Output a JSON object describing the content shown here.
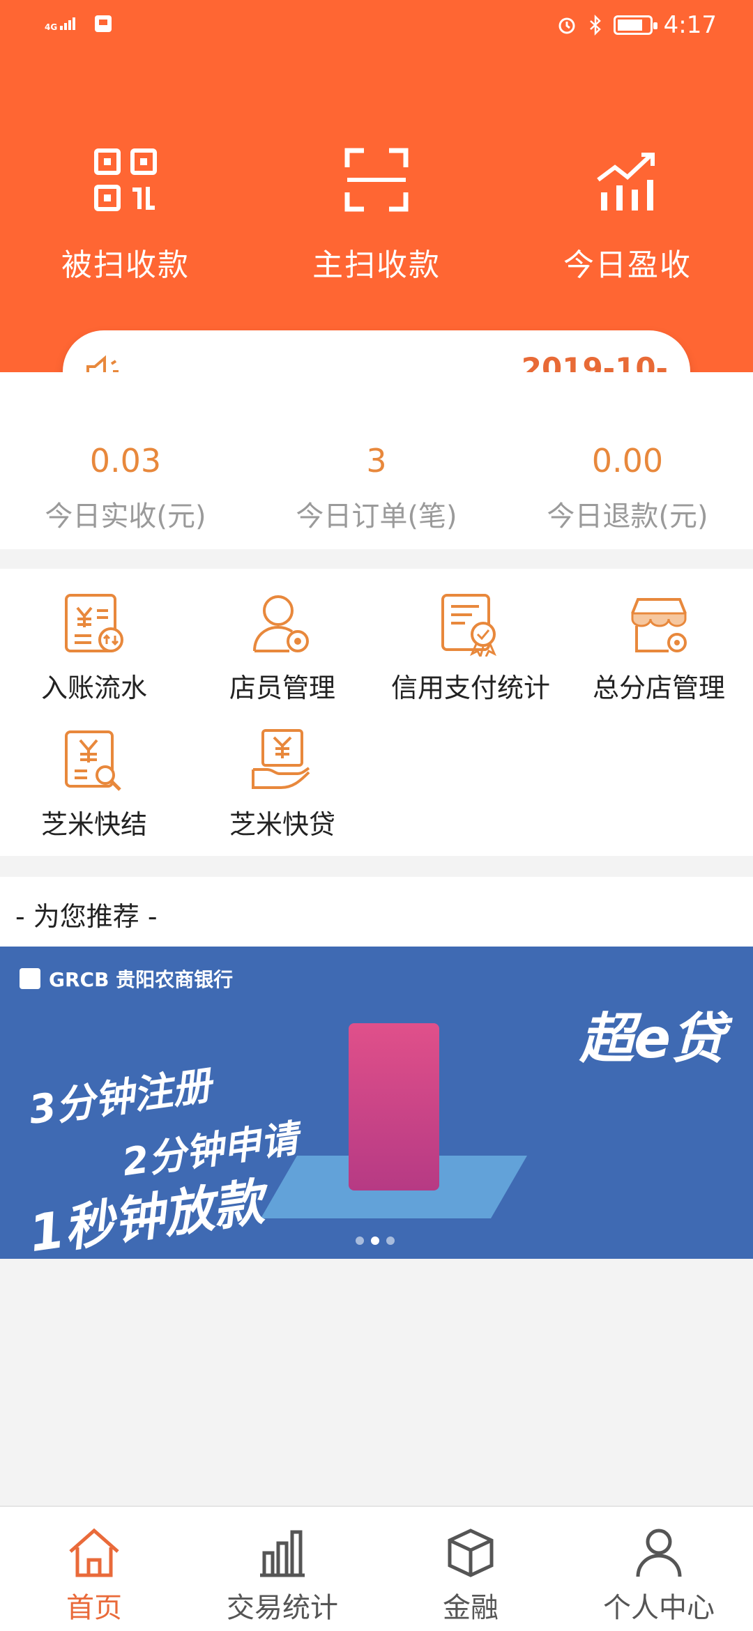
{
  "status_bar": {
    "time": "4:17",
    "network": "4G"
  },
  "quick_actions": [
    {
      "label": "被扫收款",
      "icon": "qr-code-icon"
    },
    {
      "label": "主扫收款",
      "icon": "scan-icon"
    },
    {
      "label": "今日盈收",
      "icon": "trend-chart-icon"
    }
  ],
  "notice": {
    "date": "2019-10-"
  },
  "stats": [
    {
      "value": "0.03",
      "label": "今日实收(元)"
    },
    {
      "value": "3",
      "label": "今日订单(笔)"
    },
    {
      "value": "0.00",
      "label": "今日退款(元)"
    }
  ],
  "grid_items": [
    {
      "label": "入账流水",
      "icon": "ledger-icon"
    },
    {
      "label": "店员管理",
      "icon": "staff-settings-icon"
    },
    {
      "label": "信用支付统计",
      "icon": "credit-report-icon"
    },
    {
      "label": "总分店管理",
      "icon": "store-settings-icon"
    },
    {
      "label": "芝米快结",
      "icon": "quick-settle-icon"
    },
    {
      "label": "芝米快贷",
      "icon": "quick-loan-icon"
    }
  ],
  "recommend": {
    "title": "- 为您推荐 -"
  },
  "banner": {
    "bank": "GRCB 贵阳农商银行",
    "brand": "超e贷",
    "slogan1": "3分钟注册",
    "slogan2": "2分钟申请",
    "slogan3": "1秒钟放款",
    "active_dot": 2,
    "dot_count": 3
  },
  "bottom_nav": [
    {
      "label": "首页",
      "icon": "home-icon",
      "active": true
    },
    {
      "label": "交易统计",
      "icon": "bar-chart-icon",
      "active": false
    },
    {
      "label": "金融",
      "icon": "cube-icon",
      "active": false
    },
    {
      "label": "个人中心",
      "icon": "user-icon",
      "active": false
    }
  ],
  "colors": {
    "primary": "#ff6633",
    "accent": "#e8883c",
    "banner": "#3f6ab3"
  }
}
